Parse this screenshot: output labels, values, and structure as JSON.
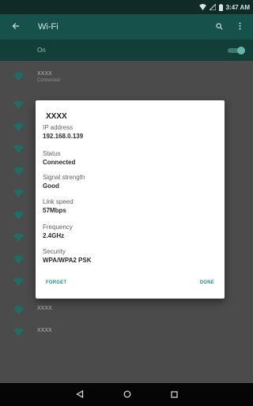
{
  "status_bar": {
    "time": "3:47 AM",
    "icons": [
      "wifi-icon",
      "signal-icon",
      "battery-icon"
    ]
  },
  "app_bar": {
    "title": "Wi-Fi",
    "icons": [
      "back-arrow-icon",
      "search-icon",
      "overflow-menu-icon"
    ]
  },
  "wifi_toggle": {
    "label": "On",
    "checked": true
  },
  "networks": [
    {
      "ssid": "XXXX",
      "status": "Connected"
    },
    {
      "ssid": "",
      "status": ""
    },
    {
      "ssid": "",
      "status": ""
    },
    {
      "ssid": "",
      "status": ""
    },
    {
      "ssid": "",
      "status": ""
    },
    {
      "ssid": "",
      "status": ""
    },
    {
      "ssid": "",
      "status": ""
    },
    {
      "ssid": "",
      "status": ""
    },
    {
      "ssid": "",
      "status": ""
    },
    {
      "ssid": "",
      "status": ""
    },
    {
      "ssid": "XXXX",
      "status": ""
    },
    {
      "ssid": "XXXX",
      "status": ""
    }
  ],
  "dialog": {
    "title": "XXXX",
    "fields": [
      {
        "label": "IP address",
        "value": "192.168.0.139"
      },
      {
        "label": "Status",
        "value": "Connected"
      },
      {
        "label": "Signal strength",
        "value": "Good"
      },
      {
        "label": "Link speed",
        "value": "57Mbps"
      },
      {
        "label": "Frequency",
        "value": "2.4GHz"
      },
      {
        "label": "Security",
        "value": "WPA/WPA2 PSK"
      }
    ],
    "forget_label": "FORGET",
    "done_label": "DONE"
  },
  "colors": {
    "accent": "#188f83",
    "app_bar": "#16524b",
    "status_bar": "#0f2a27",
    "list_background": "#4b4b4b",
    "wifi_icon": "#1f6e64"
  }
}
